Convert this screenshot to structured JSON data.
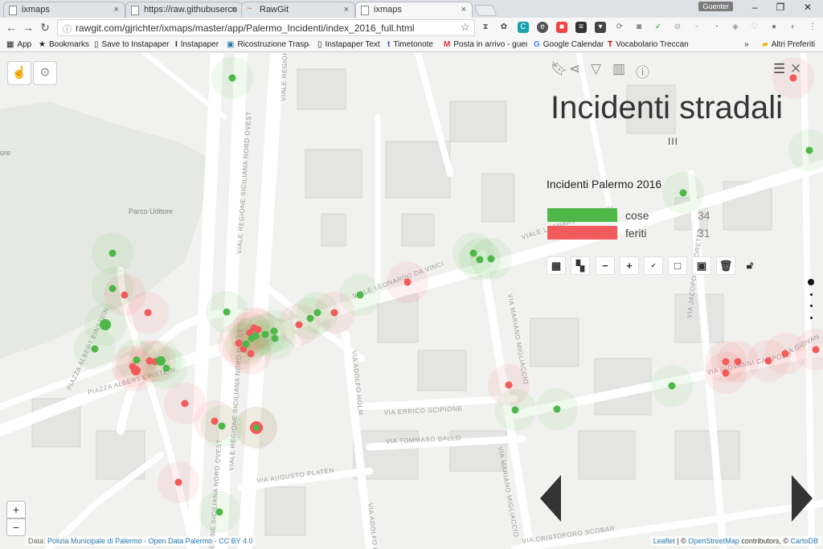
{
  "browser": {
    "tabs": [
      {
        "title": "ixmaps",
        "icon": "page-icon"
      },
      {
        "title": "https://raw.githubuserco",
        "icon": "page-icon"
      },
      {
        "title": "RawGit",
        "icon": "rawgit-icon"
      },
      {
        "title": "ixmaps",
        "icon": "page-icon"
      }
    ],
    "tab_close": "×",
    "user": "Guenter",
    "window_buttons": {
      "minimize": "–",
      "restore": "❐",
      "close": "✕"
    },
    "url": "rawgit.com/gjrichter/ixmaps/master/app/Palermo_Incidenti/index_2016_full.html",
    "nav": {
      "back": "←",
      "forward": "→",
      "reload": "↻"
    },
    "bookmarks": [
      {
        "label": "App",
        "icon": "apps-icon"
      },
      {
        "label": "Bookmarks",
        "icon": "star-icon"
      },
      {
        "label": "Save to Instapaper",
        "icon": "page-icon"
      },
      {
        "label": "Instapaper",
        "icon": "instapaper-icon"
      },
      {
        "label": "Ricostruzione Traspare",
        "icon": "image-icon"
      },
      {
        "label": "Instapaper Text",
        "icon": "page-icon"
      },
      {
        "label": "Timetonote",
        "icon": "tumblr-icon"
      },
      {
        "label": "Posta in arrivo - guent",
        "icon": "gmail-icon"
      },
      {
        "label": "Google Calendar",
        "icon": "google-icon"
      },
      {
        "label": "Vocabolario Treccani",
        "icon": "treccani-icon"
      }
    ],
    "bookmarks_more": "»",
    "other_bookmarks": "Altri Preferiti"
  },
  "map": {
    "title": "Incidenti stradali",
    "legend_title": "Incidenti Palermo 2016",
    "legend": [
      {
        "label": "cose",
        "count": "34",
        "color": "#4db848"
      },
      {
        "label": "feriti",
        "count": "31",
        "color": "#f25b5b"
      }
    ],
    "bars_icon": "III",
    "zoom_in": "+",
    "zoom_out": "−",
    "park_label": "Parco Uditore",
    "streets": {
      "viale_regione_1": "VIALE REGIONE",
      "viale_regione_2": "VIALE REGIONE SICILIANA NORD OVEST",
      "viale_regione_3": "VIALE REGIONE SICILIANA NORD OVEST",
      "viale_regione_4": "GIONE SICILIANA NORD OVEST",
      "piazza_einstein_1": "PIAZZA ALBERT EINSTEIN",
      "piazza_einstein_2": "PIAZZA ALBERT EINSTEIN",
      "viale_leonardo_1": "VIALE LEONARDO DA VINCI",
      "viale_leonardo_2": "VIALE LEONARDO DA VINCI",
      "via_mariano_1": "VIA MARIANO MIGLIACCIO",
      "via_mariano_2": "VIA MARIANO MIGLIACCIO",
      "via_adolfo_1": "VIA ADOLFO HOLM",
      "via_adolfo_2": "VIA ADOLFO HOLM",
      "via_errico": "VIA ERRICO SCIPIONE",
      "via_tommaso": "VIA TOMMASO BALLO",
      "via_augusto": "VIA AUGUSTO PLATEN",
      "via_cristoforo": "VIA CRISTOFORO SCOBAR",
      "via_jacopo": "VIA JACOPO TINTORETTO",
      "via_giovanni": "VIA GIOVANNI CAMPOLO",
      "via_giovan": "VIA GIOVAN",
      "edge_ore": "ore"
    },
    "attribution": {
      "prefix": "Data:",
      "source": "Polizia Municipale di Palermo - Open Data Palermo - CC BY 4.0",
      "leaflet": "Leaflet",
      "osm_prefix": " | © ",
      "osm": "OpenStreetMap",
      "osm_suffix": " contributors, © ",
      "carto": "CartoDB"
    }
  }
}
